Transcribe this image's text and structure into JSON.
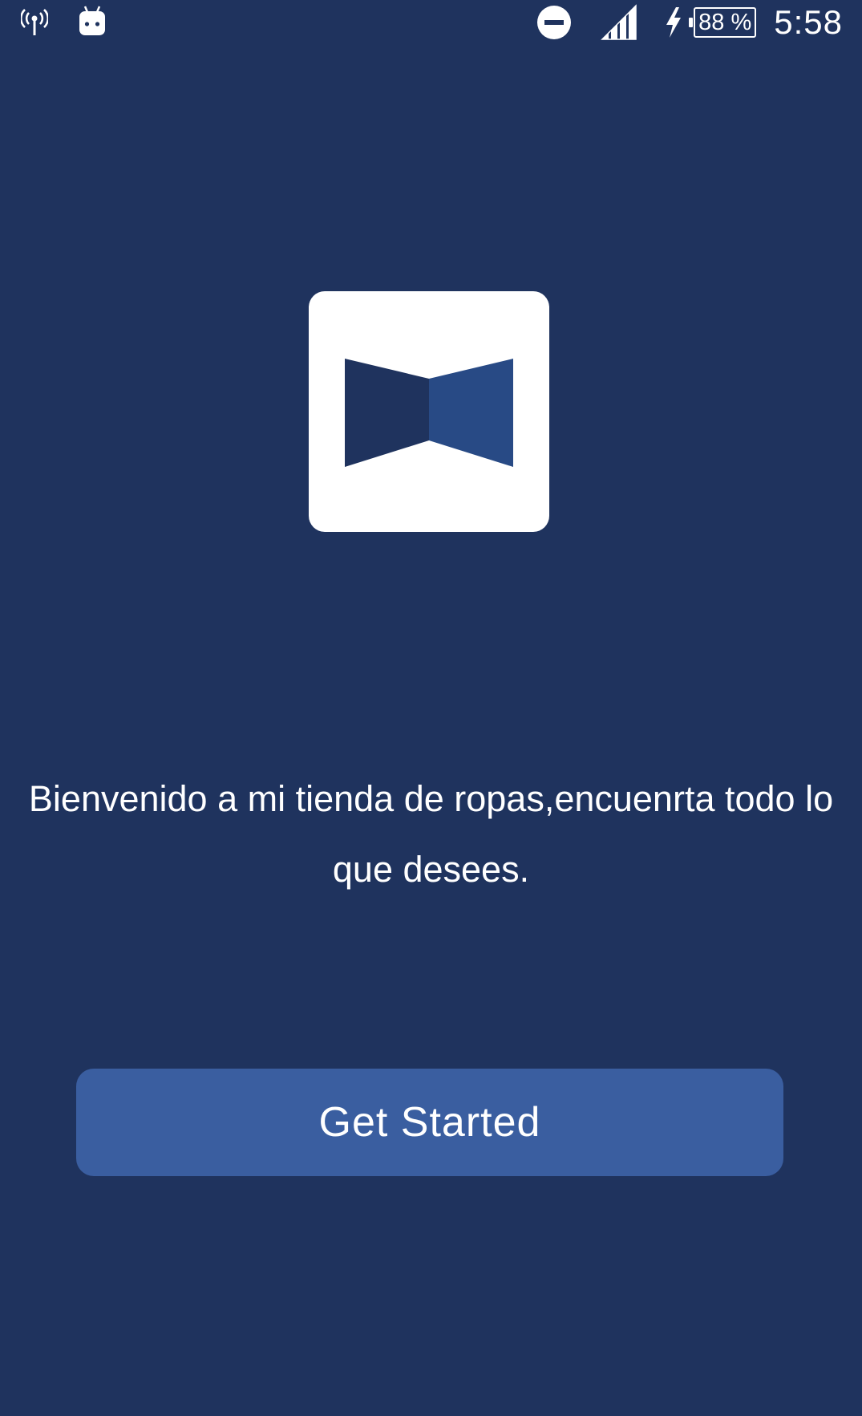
{
  "status_bar": {
    "battery_percent": "88 %",
    "time": "5:58",
    "icons": [
      "wifi-hotspot-icon",
      "android-debug-icon",
      "do-not-disturb-icon",
      "signal-strength-icon",
      "charging-bolt-icon",
      "battery-icon"
    ]
  },
  "logo": {
    "icon": "bowtie-logo-icon",
    "colors": {
      "tile": "#ffffff",
      "left_wing": "#1f335e",
      "right_wing": "#284a85"
    }
  },
  "welcome": {
    "message": "Bienvenido a mi tienda de ropas,encuenrta todo lo que desees."
  },
  "actions": {
    "get_started_label": "Get Started"
  },
  "theme": {
    "background": "#1f335e",
    "button": "#3a5ea0",
    "text": "#ffffff"
  }
}
